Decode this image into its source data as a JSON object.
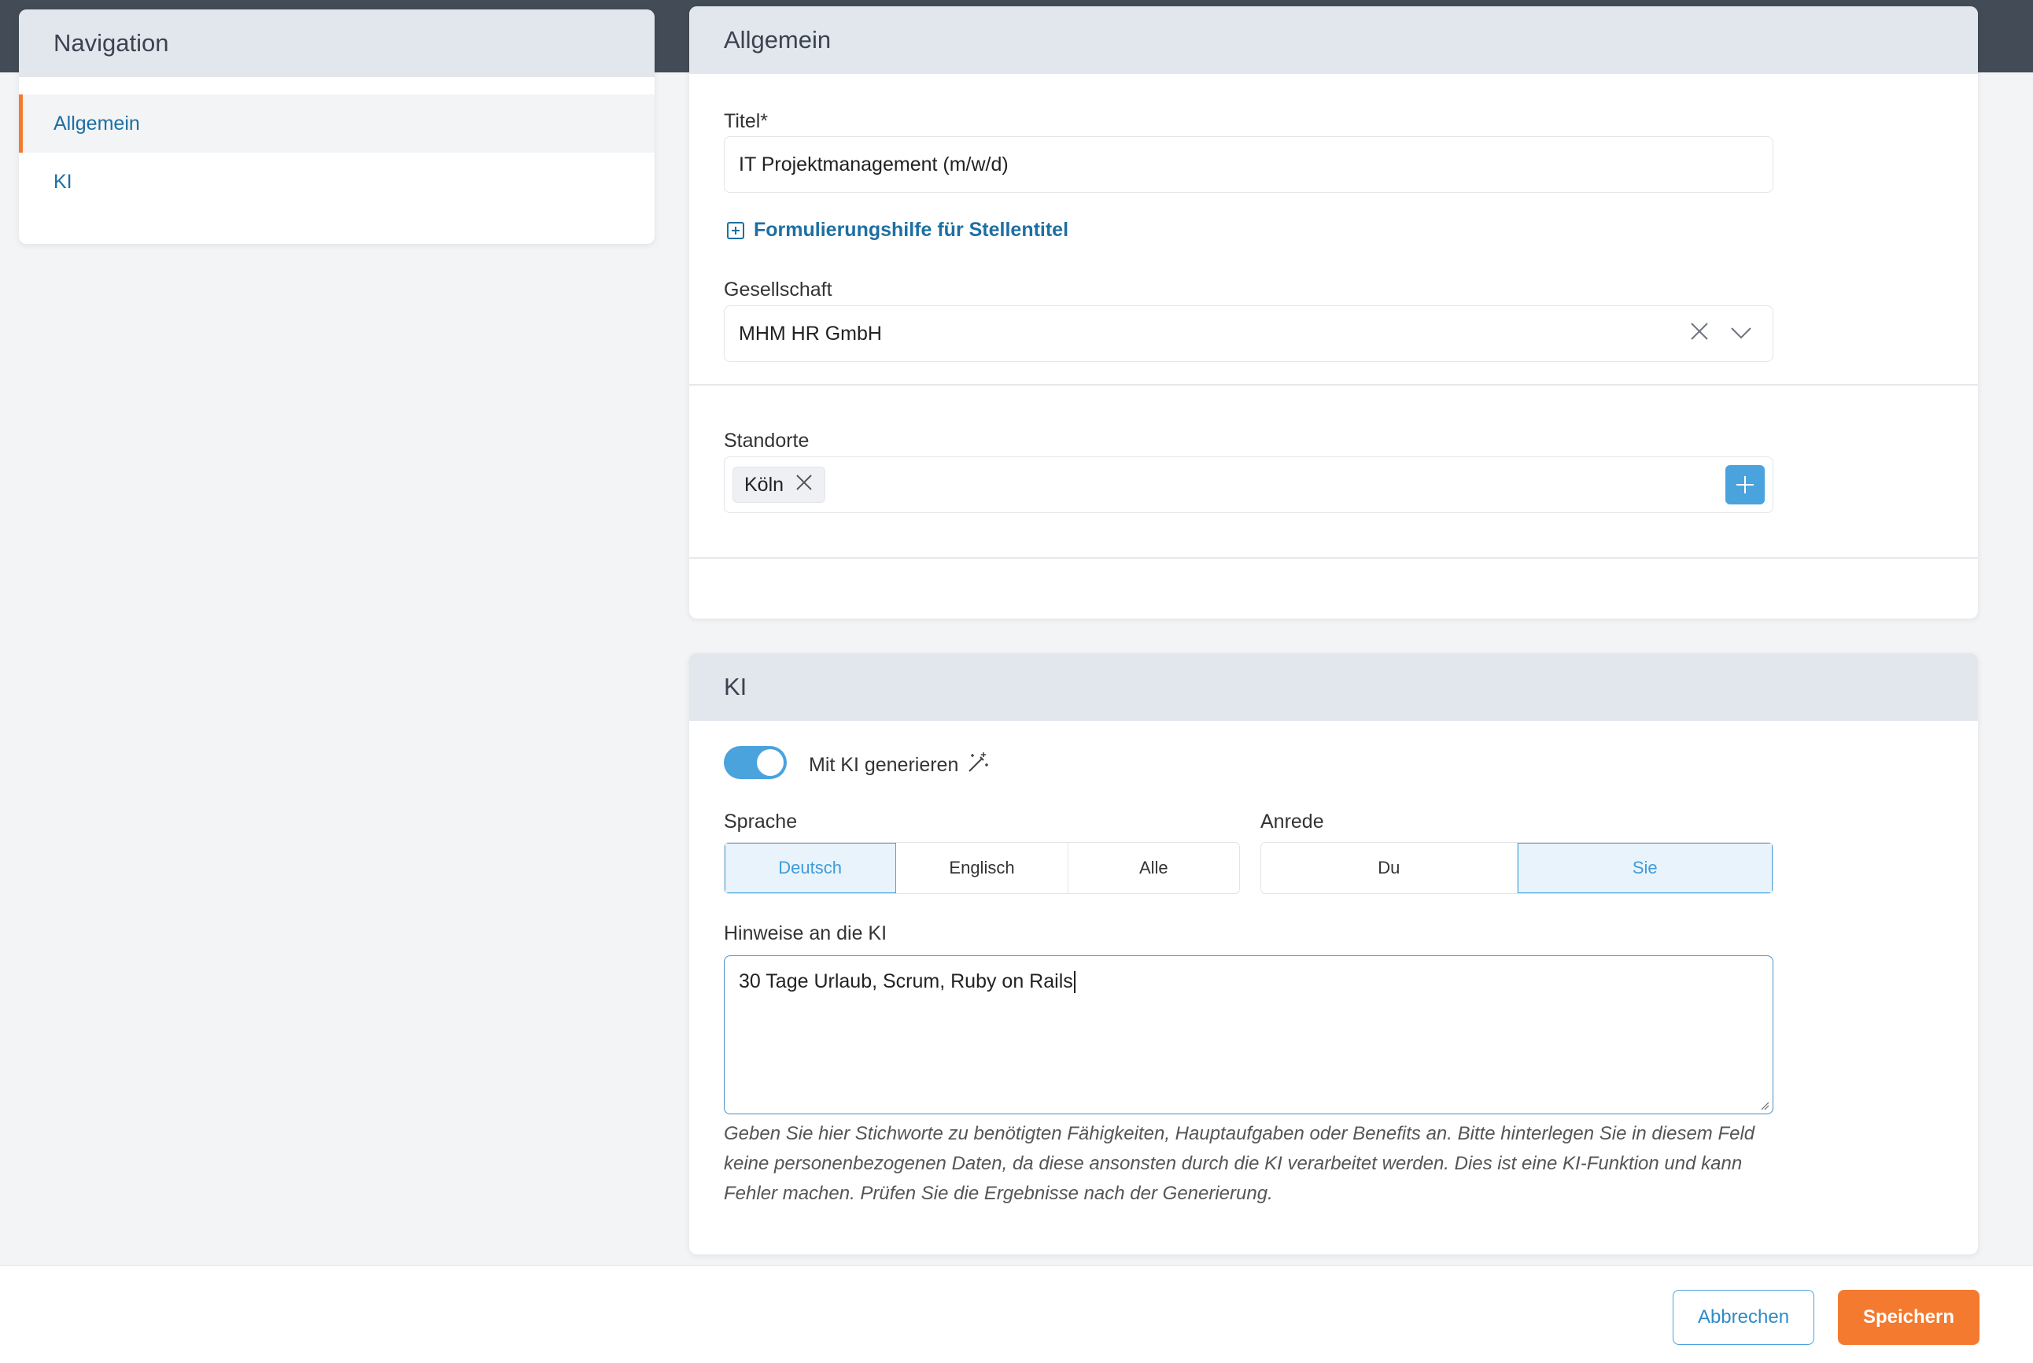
{
  "navigation": {
    "title": "Navigation",
    "items": [
      {
        "label": "Allgemein",
        "active": true
      },
      {
        "label": "KI",
        "active": false
      }
    ]
  },
  "general": {
    "title": "Allgemein",
    "title_field": {
      "label": "Titel*",
      "value": "IT Projektmanagement (m/w/d)"
    },
    "help_link": "Formulierungshilfe für Stellentitel",
    "company": {
      "label": "Gesellschaft",
      "value": "MHM HR GmbH"
    },
    "locations": {
      "label": "Standorte",
      "chips": [
        "Köln"
      ]
    }
  },
  "ki": {
    "title": "KI",
    "toggle": {
      "label": "Mit KI generieren",
      "enabled": true,
      "icon": "magic-wand-icon"
    },
    "language": {
      "label": "Sprache",
      "options": [
        "Deutsch",
        "Englisch",
        "Alle"
      ],
      "selected": "Deutsch"
    },
    "salutation": {
      "label": "Anrede",
      "options": [
        "Du",
        "Sie"
      ],
      "selected": "Sie"
    },
    "notes": {
      "label": "Hinweise an die KI",
      "value": "30 Tage Urlaub, Scrum, Ruby on Rails",
      "hint": "Geben Sie hier Stichworte zu benötigten Fähigkeiten, Hauptaufgaben oder Benefits an. Bitte hinterlegen Sie in diesem Feld keine personenbezogenen Daten, da diese ansonsten durch die KI verarbeitet werden. Dies ist eine KI-Funktion und kann Fehler machen. Prüfen Sie die Ergebnisse nach der Generierung."
    }
  },
  "footer": {
    "cancel_label": "Abbrechen",
    "save_label": "Speichern"
  },
  "colors": {
    "accent": "#4aa3dd",
    "brand_orange": "#f47a2f",
    "link": "#1d6fa3",
    "header_bg": "#e2e6ed",
    "topbar": "#434b56"
  }
}
